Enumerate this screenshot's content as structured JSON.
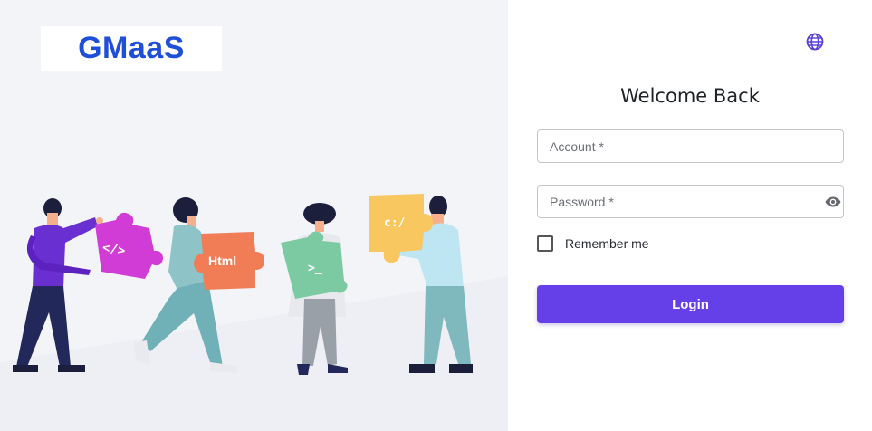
{
  "brand": {
    "logo_text": "GMaaS",
    "logo_color": "#1f4ed8"
  },
  "illustration": {
    "puzzle_labels": [
      "</>",
      "Html",
      ">_",
      "c:/"
    ]
  },
  "login": {
    "title": "Welcome Back",
    "account_placeholder": "Account *",
    "password_placeholder": "Password *",
    "remember_label": "Remember me",
    "remember_checked": false,
    "submit_label": "Login"
  },
  "icons": {
    "language": "globe-icon",
    "password_visibility": "eye-icon"
  },
  "colors": {
    "accent": "#6540e8",
    "left_background": "#f3f4f8",
    "globe_icon": "#5a3fd6"
  }
}
